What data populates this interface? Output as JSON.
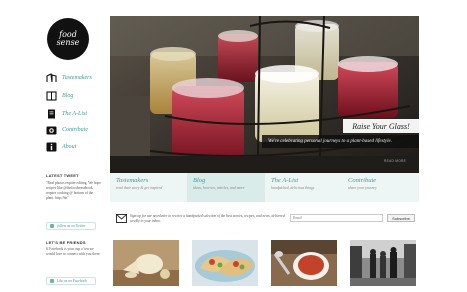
{
  "brand": {
    "logo_line1": "food",
    "logo_line2": "sense"
  },
  "nav": [
    {
      "label": "Tastemakers",
      "icon": "people-icon"
    },
    {
      "label": "Blog",
      "icon": "book-icon"
    },
    {
      "label": "The A-List",
      "icon": "clipboard-icon"
    },
    {
      "label": "Contribute",
      "icon": "camera-icon"
    },
    {
      "label": "About",
      "icon": "info-icon"
    }
  ],
  "latest_tweet": {
    "heading": "LATEST TWEET",
    "text": "\"Real photos require editing. We hope recipes like @thefoodsensebook require cooking @ bottom of the plant. http://bit\"",
    "follow_label": "follow us on Twitter"
  },
  "friends": {
    "heading": "LET'S BE FRIENDS",
    "text": "If Facebook is your cup o' tea we would love to connect with you there.",
    "like_label": "Like us on Facebook"
  },
  "hero": {
    "title": "Raise Your Glass!",
    "subtitle": "We're celebrating personal journeys to a plant-based lifestyle.",
    "more": "READ MORE"
  },
  "features": [
    {
      "title": "Tastemakers",
      "desc": "read their story & get inspired"
    },
    {
      "title": "Blog",
      "desc": "ideas, how-tos, articles, and more"
    },
    {
      "title": "The A-List",
      "desc": "handpicked, delicious things"
    },
    {
      "title": "Contribute",
      "desc": "share your journey"
    }
  ],
  "newsletter": {
    "text": "Sign up for our newsletter to receive a handpicked selection of the best stories, recipes, and news, delivered weekly to your inbox.",
    "email_placeholder": "Email",
    "button": "Subscribe"
  },
  "colors": {
    "accent": "#3f9a96",
    "feature_bg": "#eef6f5",
    "feature_active_bg": "#d9ecea"
  }
}
